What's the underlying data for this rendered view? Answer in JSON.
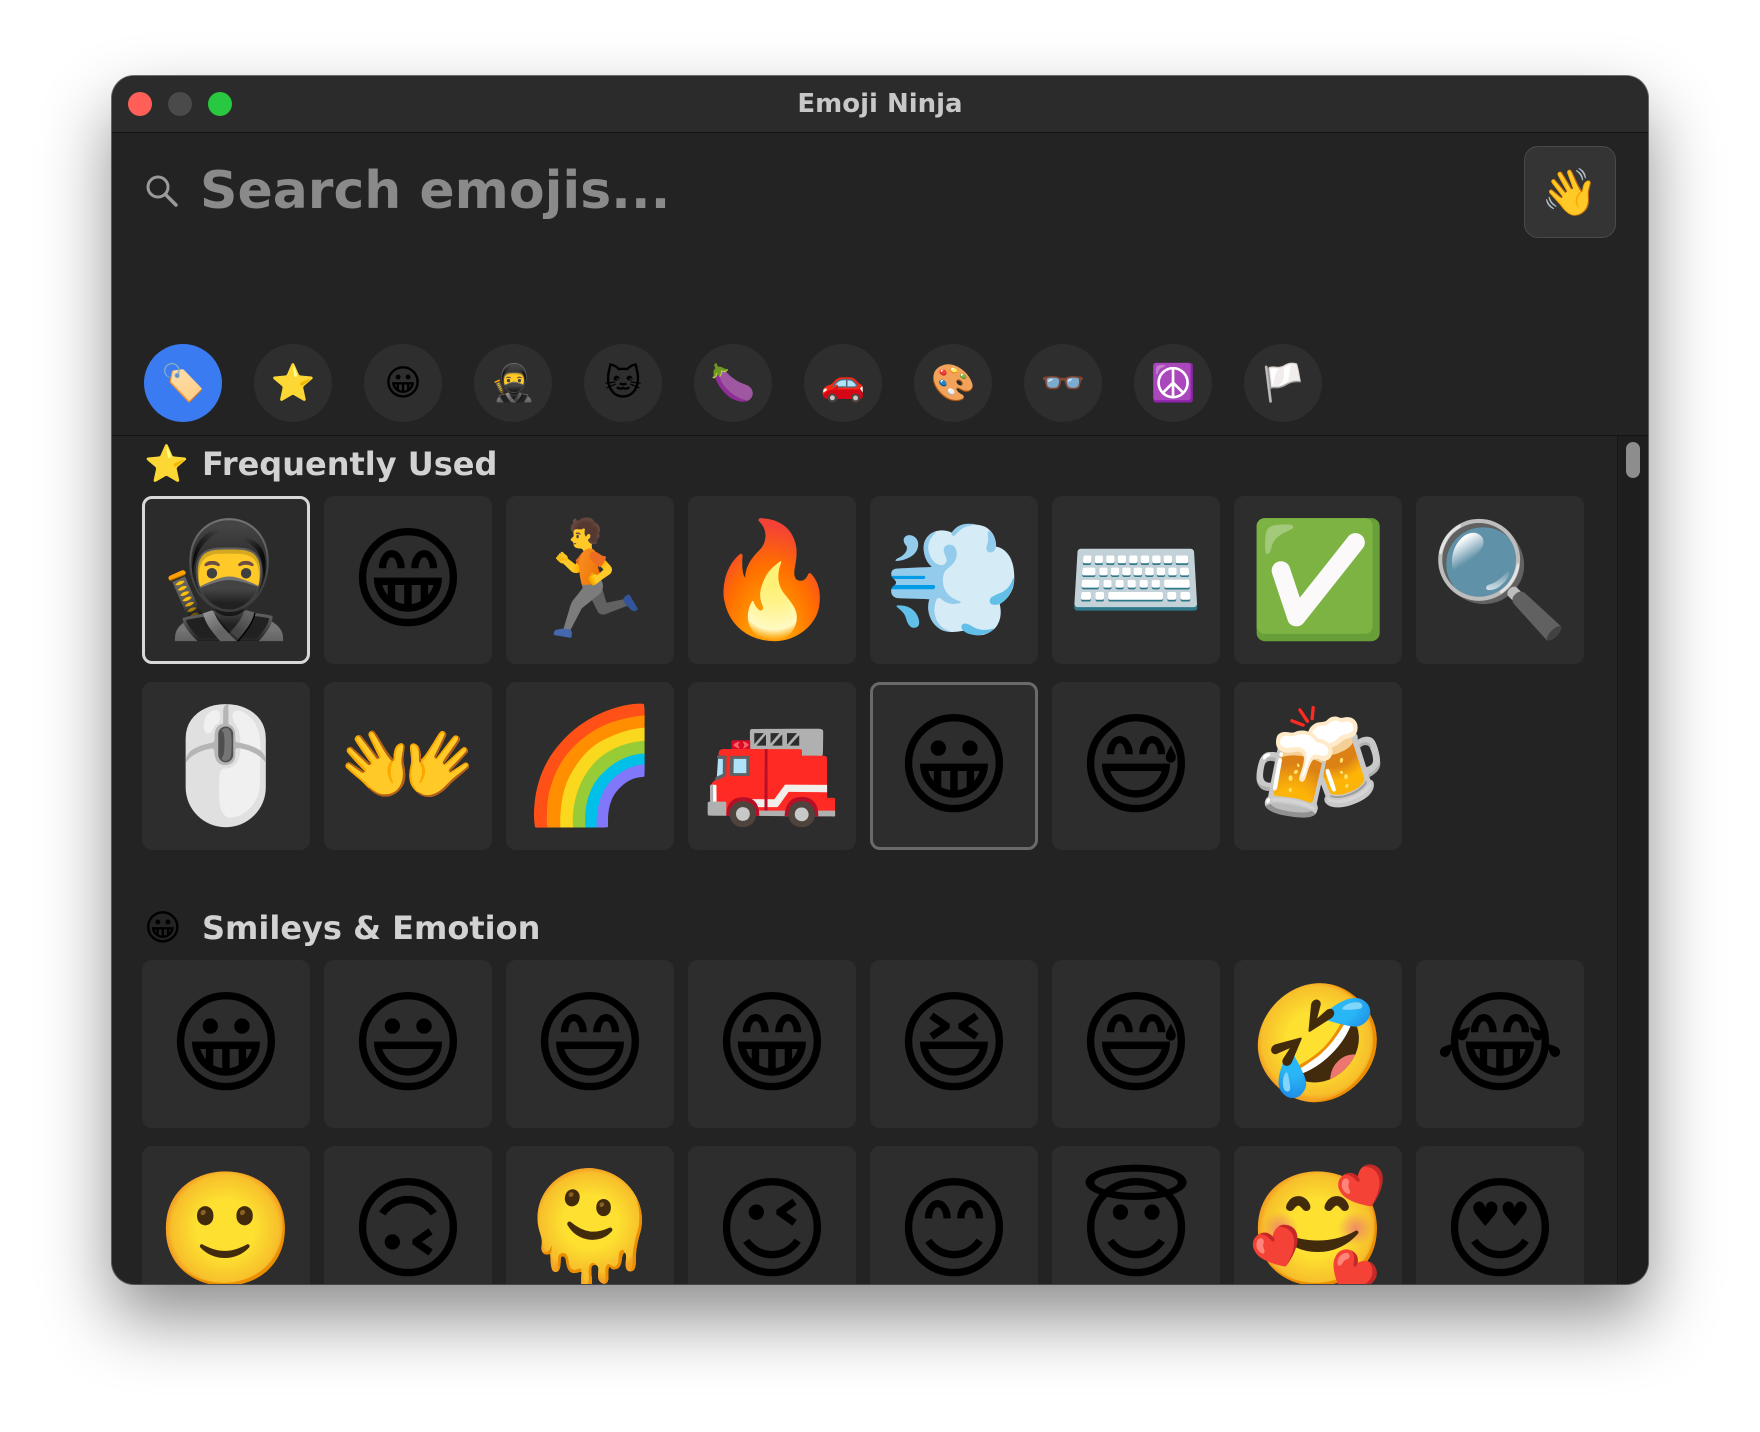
{
  "window": {
    "title": "Emoji Ninja"
  },
  "search": {
    "placeholder": "Search emojis...",
    "value": ""
  },
  "skin_tone_button": {
    "glyph": "👋"
  },
  "categories": [
    {
      "name": "tag",
      "glyph": "🏷️",
      "active": true
    },
    {
      "name": "star",
      "glyph": "⭐"
    },
    {
      "name": "smiley",
      "glyph": "😀"
    },
    {
      "name": "ninja",
      "glyph": "🥷"
    },
    {
      "name": "cat",
      "glyph": "🐱"
    },
    {
      "name": "eggplant",
      "glyph": "🍆"
    },
    {
      "name": "car",
      "glyph": "🚗"
    },
    {
      "name": "palette",
      "glyph": "🎨"
    },
    {
      "name": "glasses",
      "glyph": "👓"
    },
    {
      "name": "peace",
      "glyph": "☮️"
    },
    {
      "name": "flag",
      "glyph": "🏳️"
    }
  ],
  "sections": [
    {
      "icon": "⭐",
      "title": "Frequently Used",
      "emojis": [
        "🥷",
        "😁",
        "🏃",
        "🔥",
        "💨",
        "⌨️",
        "✅",
        "🔍",
        "🖱️",
        "👐",
        "🌈",
        "🚒",
        "😀",
        "😅",
        "🍻"
      ],
      "selected_index": 0,
      "highlighted_index": 12
    },
    {
      "icon": "😀",
      "title": "Smileys & Emotion",
      "emojis": [
        "😀",
        "😃",
        "😄",
        "😁",
        "😆",
        "😅",
        "🤣",
        "😂",
        "🙂",
        "🙃",
        "🫠",
        "😉",
        "😊",
        "😇",
        "🥰",
        "😍",
        "😈",
        "😘",
        "😗",
        "☺️",
        "😚",
        "😙",
        "🥲",
        "😋"
      ]
    }
  ]
}
